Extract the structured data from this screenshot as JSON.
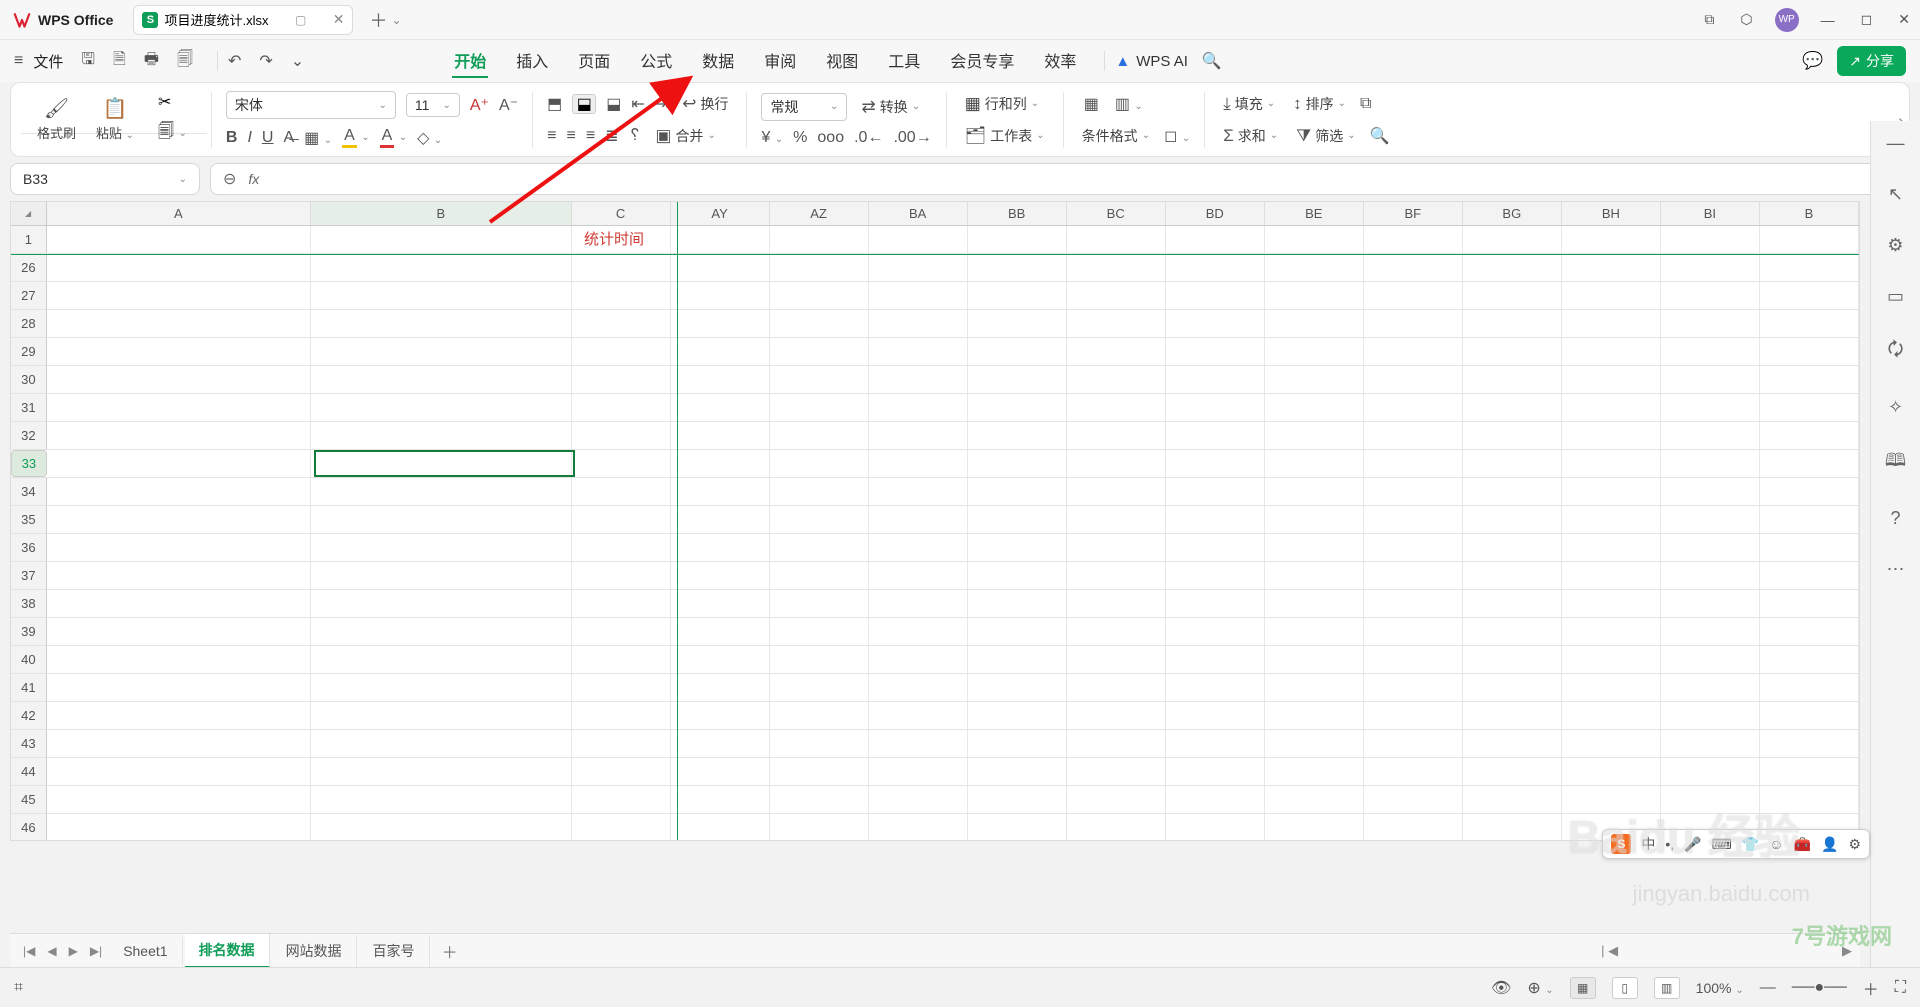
{
  "titlebar": {
    "app_name": "WPS Office",
    "tab_badge": "S",
    "tab_name": "项目进度统计.xlsx",
    "avatar_text": "WP"
  },
  "menubar": {
    "file": "文件",
    "items": [
      "开始",
      "插入",
      "页面",
      "公式",
      "数据",
      "审阅",
      "视图",
      "工具",
      "会员专享",
      "效率"
    ],
    "active_index": 0,
    "wps_ai": "WPS AI",
    "share": "分享"
  },
  "ribbon": {
    "format_painter": "格式刷",
    "paste": "粘贴",
    "font_name": "宋体",
    "font_size": "11",
    "wrap": "换行",
    "merge": "合并",
    "number_format": "常规",
    "convert": "转换",
    "rows_cols": "行和列",
    "worksheet": "工作表",
    "cond_fmt": "条件格式",
    "fill": "填充",
    "sort": "排序",
    "sum": "求和",
    "filter": "筛选"
  },
  "fx": {
    "cell_ref": "B33",
    "fx_label": "fx"
  },
  "sheet": {
    "col_labels": [
      "A",
      "B",
      "C",
      "AY",
      "AZ",
      "BA",
      "BB",
      "BC",
      "BD",
      "BE",
      "BF",
      "BG",
      "BH",
      "BI",
      "B"
    ],
    "row_labels": [
      "1",
      "26",
      "27",
      "28",
      "29",
      "30",
      "31",
      "32",
      "33",
      "34",
      "35",
      "36",
      "37",
      "38",
      "39",
      "40",
      "41",
      "42",
      "43",
      "44",
      "45",
      "46"
    ],
    "row1_c_text": "统计时间",
    "selected_row": "33"
  },
  "tabs": {
    "nav": [
      "|◀",
      "◀",
      "▶",
      "▶|"
    ],
    "items": [
      "Sheet1",
      "排名数据",
      "网站数据",
      "百家号"
    ],
    "active_index": 1
  },
  "status": {
    "zoom": "100%"
  },
  "watermark": {
    "brand": "Baidu 经验",
    "url": "jingyan.baidu.com",
    "site": "7号游戏网"
  },
  "ime": {
    "lang": "中"
  }
}
